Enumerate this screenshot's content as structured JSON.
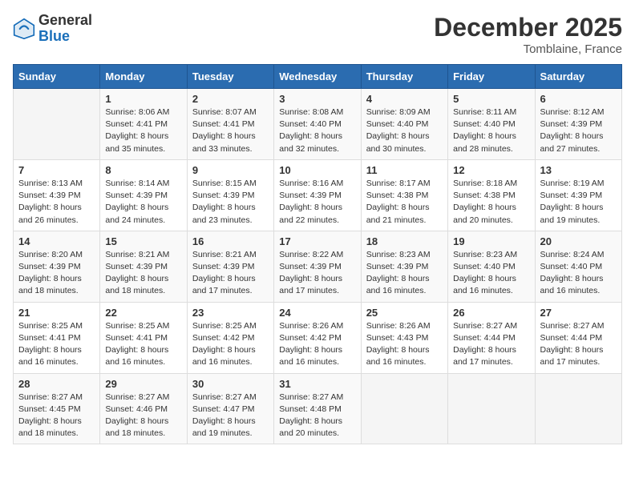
{
  "logo": {
    "general": "General",
    "blue": "Blue"
  },
  "title": "December 2025",
  "location": "Tomblaine, France",
  "days_header": [
    "Sunday",
    "Monday",
    "Tuesday",
    "Wednesday",
    "Thursday",
    "Friday",
    "Saturday"
  ],
  "weeks": [
    [
      {
        "day": "",
        "info": ""
      },
      {
        "day": "1",
        "info": "Sunrise: 8:06 AM\nSunset: 4:41 PM\nDaylight: 8 hours\nand 35 minutes."
      },
      {
        "day": "2",
        "info": "Sunrise: 8:07 AM\nSunset: 4:41 PM\nDaylight: 8 hours\nand 33 minutes."
      },
      {
        "day": "3",
        "info": "Sunrise: 8:08 AM\nSunset: 4:40 PM\nDaylight: 8 hours\nand 32 minutes."
      },
      {
        "day": "4",
        "info": "Sunrise: 8:09 AM\nSunset: 4:40 PM\nDaylight: 8 hours\nand 30 minutes."
      },
      {
        "day": "5",
        "info": "Sunrise: 8:11 AM\nSunset: 4:40 PM\nDaylight: 8 hours\nand 28 minutes."
      },
      {
        "day": "6",
        "info": "Sunrise: 8:12 AM\nSunset: 4:39 PM\nDaylight: 8 hours\nand 27 minutes."
      }
    ],
    [
      {
        "day": "7",
        "info": "Sunrise: 8:13 AM\nSunset: 4:39 PM\nDaylight: 8 hours\nand 26 minutes."
      },
      {
        "day": "8",
        "info": "Sunrise: 8:14 AM\nSunset: 4:39 PM\nDaylight: 8 hours\nand 24 minutes."
      },
      {
        "day": "9",
        "info": "Sunrise: 8:15 AM\nSunset: 4:39 PM\nDaylight: 8 hours\nand 23 minutes."
      },
      {
        "day": "10",
        "info": "Sunrise: 8:16 AM\nSunset: 4:39 PM\nDaylight: 8 hours\nand 22 minutes."
      },
      {
        "day": "11",
        "info": "Sunrise: 8:17 AM\nSunset: 4:38 PM\nDaylight: 8 hours\nand 21 minutes."
      },
      {
        "day": "12",
        "info": "Sunrise: 8:18 AM\nSunset: 4:38 PM\nDaylight: 8 hours\nand 20 minutes."
      },
      {
        "day": "13",
        "info": "Sunrise: 8:19 AM\nSunset: 4:39 PM\nDaylight: 8 hours\nand 19 minutes."
      }
    ],
    [
      {
        "day": "14",
        "info": "Sunrise: 8:20 AM\nSunset: 4:39 PM\nDaylight: 8 hours\nand 18 minutes."
      },
      {
        "day": "15",
        "info": "Sunrise: 8:21 AM\nSunset: 4:39 PM\nDaylight: 8 hours\nand 18 minutes."
      },
      {
        "day": "16",
        "info": "Sunrise: 8:21 AM\nSunset: 4:39 PM\nDaylight: 8 hours\nand 17 minutes."
      },
      {
        "day": "17",
        "info": "Sunrise: 8:22 AM\nSunset: 4:39 PM\nDaylight: 8 hours\nand 17 minutes."
      },
      {
        "day": "18",
        "info": "Sunrise: 8:23 AM\nSunset: 4:39 PM\nDaylight: 8 hours\nand 16 minutes."
      },
      {
        "day": "19",
        "info": "Sunrise: 8:23 AM\nSunset: 4:40 PM\nDaylight: 8 hours\nand 16 minutes."
      },
      {
        "day": "20",
        "info": "Sunrise: 8:24 AM\nSunset: 4:40 PM\nDaylight: 8 hours\nand 16 minutes."
      }
    ],
    [
      {
        "day": "21",
        "info": "Sunrise: 8:25 AM\nSunset: 4:41 PM\nDaylight: 8 hours\nand 16 minutes."
      },
      {
        "day": "22",
        "info": "Sunrise: 8:25 AM\nSunset: 4:41 PM\nDaylight: 8 hours\nand 16 minutes."
      },
      {
        "day": "23",
        "info": "Sunrise: 8:25 AM\nSunset: 4:42 PM\nDaylight: 8 hours\nand 16 minutes."
      },
      {
        "day": "24",
        "info": "Sunrise: 8:26 AM\nSunset: 4:42 PM\nDaylight: 8 hours\nand 16 minutes."
      },
      {
        "day": "25",
        "info": "Sunrise: 8:26 AM\nSunset: 4:43 PM\nDaylight: 8 hours\nand 16 minutes."
      },
      {
        "day": "26",
        "info": "Sunrise: 8:27 AM\nSunset: 4:44 PM\nDaylight: 8 hours\nand 17 minutes."
      },
      {
        "day": "27",
        "info": "Sunrise: 8:27 AM\nSunset: 4:44 PM\nDaylight: 8 hours\nand 17 minutes."
      }
    ],
    [
      {
        "day": "28",
        "info": "Sunrise: 8:27 AM\nSunset: 4:45 PM\nDaylight: 8 hours\nand 18 minutes."
      },
      {
        "day": "29",
        "info": "Sunrise: 8:27 AM\nSunset: 4:46 PM\nDaylight: 8 hours\nand 18 minutes."
      },
      {
        "day": "30",
        "info": "Sunrise: 8:27 AM\nSunset: 4:47 PM\nDaylight: 8 hours\nand 19 minutes."
      },
      {
        "day": "31",
        "info": "Sunrise: 8:27 AM\nSunset: 4:48 PM\nDaylight: 8 hours\nand 20 minutes."
      },
      {
        "day": "",
        "info": ""
      },
      {
        "day": "",
        "info": ""
      },
      {
        "day": "",
        "info": ""
      }
    ]
  ]
}
